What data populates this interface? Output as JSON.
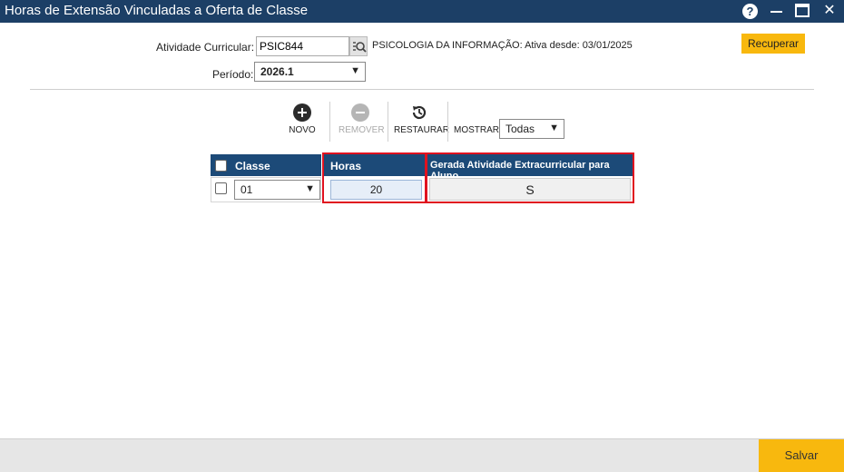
{
  "window": {
    "title": "Horas de Extensão Vinculadas a Oferta de Classe",
    "help_glyph": "?",
    "close_glyph": "✕"
  },
  "form": {
    "atividade_label": "Atividade Curricular:",
    "atividade_value": "PSIC844",
    "atividade_desc": "PSICOLOGIA DA INFORMAÇÃO: Ativa desde: 03/01/2025",
    "periodo_label": "Período:",
    "periodo_value": "2026.1",
    "recuperar_label": "Recuperar"
  },
  "toolbar": {
    "novo_label": "NOVO",
    "remover_label": "REMOVER",
    "restaurar_label": "RESTAURAR",
    "mostrar_label": "MOSTRAR:",
    "mostrar_value": "Todas"
  },
  "grid": {
    "headers": {
      "classe": "Classe",
      "horas": "Horas",
      "gerada": "Gerada Atividade Extracurricular para Aluno"
    },
    "rows": [
      {
        "classe": "01",
        "horas": "20",
        "gerada": "S"
      }
    ]
  },
  "footer": {
    "salvar_label": "Salvar"
  }
}
